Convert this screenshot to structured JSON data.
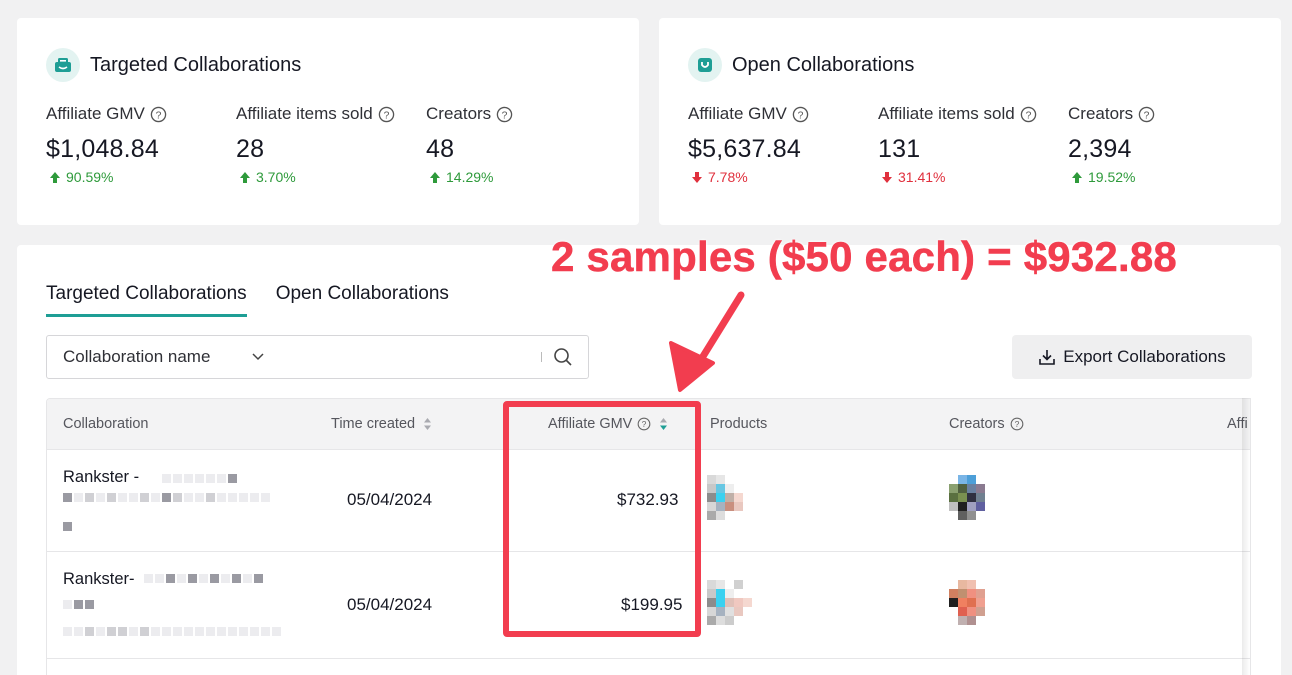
{
  "colors": {
    "accent": "#1e9e95",
    "up": "#2e9a3b",
    "down": "#e0303d",
    "annotation": "#f23d4f"
  },
  "targeted_card": {
    "title": "Targeted Collaborations",
    "icon": "collab-badge-icon",
    "metrics": [
      {
        "label": "Affiliate GMV",
        "value": "$1,048.84",
        "delta": "90.59%",
        "direction": "up"
      },
      {
        "label": "Affiliate items sold",
        "value": "28",
        "delta": "3.70%",
        "direction": "up"
      },
      {
        "label": "Creators",
        "value": "48",
        "delta": "14.29%",
        "direction": "up"
      }
    ]
  },
  "open_card": {
    "title": "Open Collaborations",
    "icon": "shopping-bag-icon",
    "metrics": [
      {
        "label": "Affiliate GMV",
        "value": "$5,637.84",
        "delta": "7.78%",
        "direction": "down"
      },
      {
        "label": "Affiliate items sold",
        "value": "131",
        "delta": "31.41%",
        "direction": "down"
      },
      {
        "label": "Creators",
        "value": "2,394",
        "delta": "19.52%",
        "direction": "up"
      }
    ]
  },
  "tabs": [
    "Targeted Collaborations",
    "Open Collaborations"
  ],
  "active_tab": 0,
  "search": {
    "select_value": "Collaboration name",
    "placeholder": ""
  },
  "export_label": "Export Collaborations",
  "table": {
    "columns": [
      "Collaboration",
      "Time created",
      "Affiliate GMV",
      "Products",
      "Creators",
      "Affi"
    ],
    "rows": [
      {
        "name": "Rankster -",
        "time": "05/04/2024",
        "gmv": "$732.93"
      },
      {
        "name": "Rankster-",
        "time": "05/04/2024",
        "gmv": "$199.95"
      }
    ]
  },
  "annotation": {
    "text": "2 samples ($50 each) = $932.88"
  }
}
